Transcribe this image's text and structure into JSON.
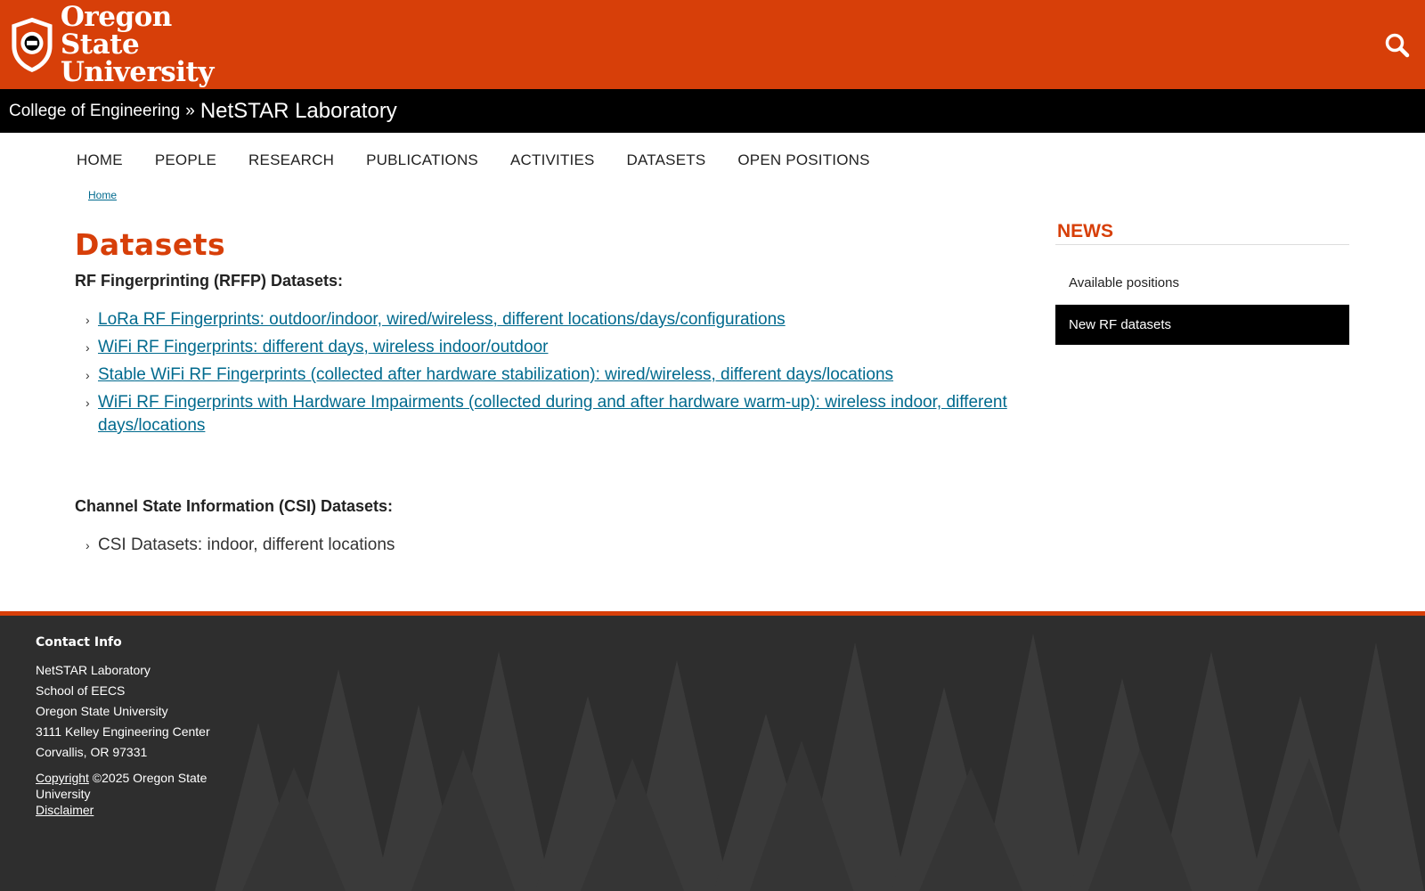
{
  "header": {
    "logo_line1": "Oregon State",
    "logo_line2": "University",
    "search_icon": "search-icon",
    "brand_color": "#d73f09"
  },
  "unitbar": {
    "college": "College of Engineering",
    "separator": "»",
    "unit": "NetSTAR Laboratory"
  },
  "nav": {
    "items": [
      "HOME",
      "PEOPLE",
      "RESEARCH",
      "PUBLICATIONS",
      "ACTIVITIES",
      "DATASETS",
      "OPEN POSITIONS"
    ]
  },
  "breadcrumb": {
    "home": "Home"
  },
  "main": {
    "title": "Datasets",
    "rffp_heading": "RF Fingerprinting (RFFP) Datasets:",
    "rffp_items": [
      "LoRa RF Fingerprints: outdoor/indoor, wired/wireless, different locations/days/configurations",
      "WiFi RF Fingerprints: different days, wireless indoor/outdoor",
      "Stable WiFi RF Fingerprints (collected after hardware stabilization): wired/wireless, different days/locations",
      "WiFi RF Fingerprints with Hardware Impairments (collected during and after hardware warm-up): wireless indoor, different days/locations"
    ],
    "csi_heading": "Channel State Information (CSI) Datasets:",
    "csi_items": [
      "CSI Datasets: indoor, different locations"
    ],
    "bullet": "›"
  },
  "sidebar": {
    "heading": "NEWS",
    "items": [
      "Available positions",
      "New RF datasets"
    ]
  },
  "footer": {
    "heading": "Contact Info",
    "address": [
      "NetSTAR Laboratory",
      "School of EECS",
      "Oregon State University",
      "3111 Kelley Engineering Center",
      "Corvallis, OR 97331"
    ],
    "copyright_link": "Copyright",
    "copyright_text": " ©2025 Oregon State University",
    "disclaimer": "Disclaimer"
  }
}
